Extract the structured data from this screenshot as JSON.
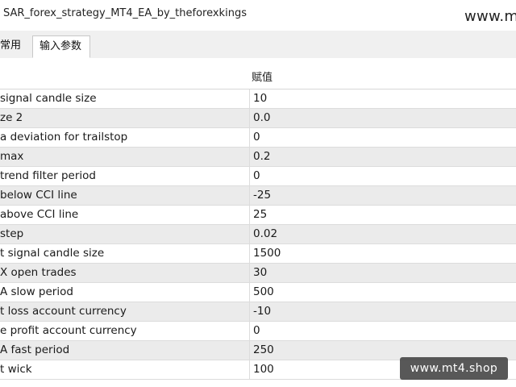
{
  "window": {
    "title": "SAR_forex_strategy_MT4_EA_by_theforexkings",
    "watermark_top": "www.mt"
  },
  "tabs": [
    {
      "label": "常用"
    },
    {
      "label": "输入参数"
    }
  ],
  "table": {
    "value_header": "赋值",
    "rows": [
      {
        "name": " signal candle size",
        "value": "10"
      },
      {
        "name": "ze 2",
        "value": "0.0"
      },
      {
        "name": "a deviation for trailstop",
        "value": "0"
      },
      {
        "name": " max",
        "value": "0.2"
      },
      {
        "name": "trend filter period",
        "value": "0"
      },
      {
        "name": " below CCI line",
        "value": "-25"
      },
      {
        "name": " above CCI line",
        "value": "25"
      },
      {
        "name": " step",
        "value": "0.02"
      },
      {
        "name": "t signal candle size",
        "value": "1500"
      },
      {
        "name": "X open trades",
        "value": "30"
      },
      {
        "name": "A slow period",
        "value": "500"
      },
      {
        "name": "t loss account currency",
        "value": "-10"
      },
      {
        "name": "e profit account currency",
        "value": "0"
      },
      {
        "name": "A fast period",
        "value": "250"
      },
      {
        "name": "t wick",
        "value": "100"
      }
    ]
  },
  "watermark_badge": "www.mt4.shop"
}
